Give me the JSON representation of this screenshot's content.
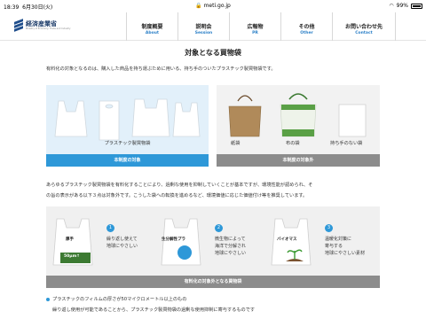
{
  "status_bar": {
    "time": "18:39",
    "date": "6月30日(火)",
    "url": "meti.go.jp",
    "battery": "99%"
  },
  "header": {
    "logo_name": "経済産業省",
    "logo_sub": "Ministry of Economy, Trade and Industry",
    "nav": [
      {
        "jp": "制度概要",
        "en": "About"
      },
      {
        "jp": "説明会",
        "en": "Session"
      },
      {
        "jp": "広報物",
        "en": "PR"
      },
      {
        "jp": "その他",
        "en": "Other"
      },
      {
        "jp": "お問い合わせ先",
        "en": "Contact"
      }
    ]
  },
  "main": {
    "title": "対象となる買物袋",
    "intro": "有料化の対象となるのは、購入した商品を持ち運ぶために用いる、持ち手のついたプラスチック製買物袋です。",
    "target_panel": {
      "caption": "プラスチック製買物袋",
      "footer": "本制度の対象"
    },
    "nontarget_panel": {
      "captions": [
        "紙袋",
        "布の袋",
        "持ち手のない袋"
      ],
      "footer": "本制度の対象外"
    },
    "para2_line1": "あらゆるプラスチック製買物袋を有料化することにより、過剰な使用を抑制していくことが基本ですが、環境性能が認められ、そ",
    "para2_line2": "の旨の表示がある以下３点は対象外です。こうした袋への転換を進めるなど、環境価値に応じた価値付け等を推奨しています。",
    "exempt": {
      "items": [
        {
          "num": "1",
          "text1": "繰り返し使えて",
          "text2": "地球にやさしい",
          "label1": "厚手",
          "label2": "50μm↑"
        },
        {
          "num": "2",
          "text1": "微生物によって",
          "text2": "海洋で分解され",
          "text3": "地球にやさしい",
          "label1": "生分解性プラ"
        },
        {
          "num": "3",
          "text1": "温暖化対策に",
          "text2": "寄与する",
          "text3": "地球にやさしい素材",
          "label1": "バイオマス"
        }
      ],
      "footer": "有料化の対象外となる買物袋"
    },
    "bullet1": "プラスチックのフィルムの厚さが50マイクロメートル以上のもの",
    "bullet1b": "繰り返し使用が可能であることから、プラスチック製買物袋の過剰な使用抑制に寄与するものです"
  },
  "colors": {
    "accent": "#2e98d8",
    "brand": "#1f4e8c",
    "gray": "#8c8c8c"
  }
}
